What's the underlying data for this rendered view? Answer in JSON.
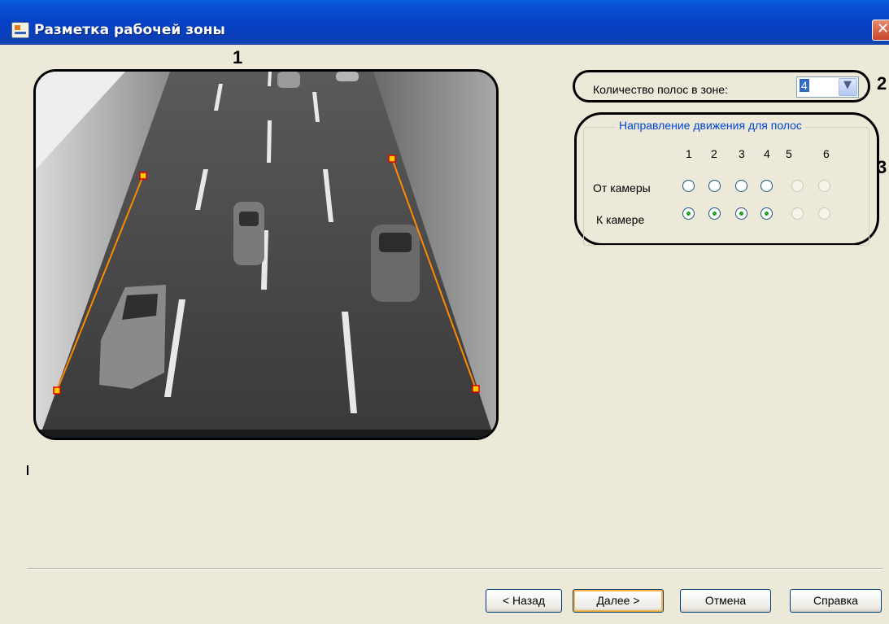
{
  "window": {
    "title": "Разметка рабочей зоны"
  },
  "annotations": [
    "1",
    "2",
    "3"
  ],
  "lanes": {
    "count_label": "Количество полос в зоне:",
    "count_value": "4"
  },
  "direction": {
    "group_title": "Направление движения для полос",
    "columns": [
      "1",
      "2",
      "3",
      "4",
      "5",
      "6"
    ],
    "rows": [
      {
        "label": "От камеры",
        "states": [
          "unchecked",
          "unchecked",
          "unchecked",
          "unchecked",
          "disabled",
          "disabled"
        ]
      },
      {
        "label": "К камере",
        "states": [
          "checked",
          "checked",
          "checked",
          "checked",
          "disabled",
          "disabled"
        ]
      }
    ]
  },
  "buttons": {
    "back": "< Назад",
    "next": "Далее >",
    "cancel": "Отмена",
    "help": "Справка"
  },
  "colors": {
    "zone_line": "#ff8a00",
    "zone_handle_fill": "#ffcc00",
    "zone_handle_border": "#e00000",
    "radio_checked": "#21a121",
    "group_title": "#0046d5"
  }
}
